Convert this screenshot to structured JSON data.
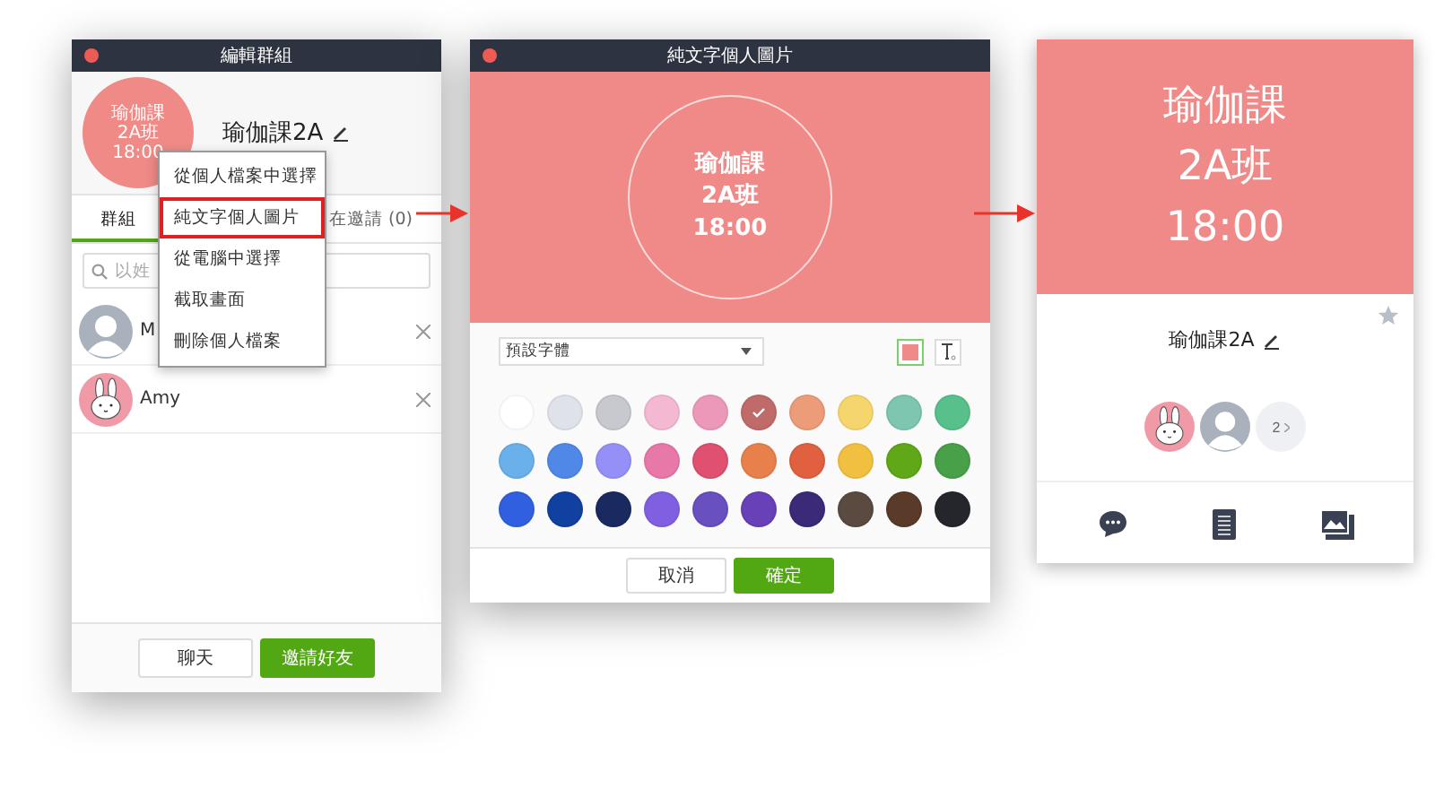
{
  "edit_group_window": {
    "title": "編輯群組",
    "avatar_lines": [
      "瑜伽課",
      "2A班",
      "18:00"
    ],
    "group_name": "瑜伽課2A",
    "tabs": [
      {
        "label": "群組",
        "selected": true
      },
      {
        "label": "在邀請 (0)",
        "selected": false
      }
    ],
    "search": {
      "placeholder": "以姓"
    },
    "members": [
      {
        "name": "M",
        "kind": "person"
      },
      {
        "name": "Amy",
        "kind": "bunny"
      }
    ],
    "buttons": [
      {
        "label": "聊天",
        "kind": "secondary"
      },
      {
        "label": "邀請好友",
        "kind": "primary"
      }
    ],
    "menu": [
      {
        "label": "從個人檔案中選擇",
        "selected": false
      },
      {
        "label": "純文字個人圖片",
        "selected": true
      },
      {
        "label": "從電腦中選擇",
        "selected": false
      },
      {
        "label": "截取畫面",
        "selected": false
      },
      {
        "label": "刪除個人檔案",
        "selected": false
      }
    ]
  },
  "text_image_window": {
    "title": "純文字個人圖片",
    "preview_lines": [
      "瑜伽課",
      "2A班",
      "18:00"
    ],
    "font_select": {
      "value": "預設字體"
    },
    "tools": [
      {
        "kind": "background",
        "selected": true
      },
      {
        "kind": "text",
        "selected": false
      }
    ],
    "palette": [
      {
        "color": "#ffffff",
        "selected": false
      },
      {
        "color": "#dfe2e9",
        "selected": false
      },
      {
        "color": "#c8c9ce",
        "selected": false
      },
      {
        "color": "#f4b8d2",
        "selected": false
      },
      {
        "color": "#ec98b8",
        "selected": false
      },
      {
        "color": "#c06a6a",
        "selected": true
      },
      {
        "color": "#ec9c78",
        "selected": false
      },
      {
        "color": "#f5d66e",
        "selected": false
      },
      {
        "color": "#7ec6b0",
        "selected": false
      },
      {
        "color": "#58c08a",
        "selected": false
      },
      {
        "color": "#6ab0ea",
        "selected": false
      },
      {
        "color": "#5088e8",
        "selected": false
      },
      {
        "color": "#9590f8",
        "selected": false
      },
      {
        "color": "#e878a8",
        "selected": false
      },
      {
        "color": "#e05070",
        "selected": false
      },
      {
        "color": "#e8804c",
        "selected": false
      },
      {
        "color": "#e06040",
        "selected": false
      },
      {
        "color": "#f2c040",
        "selected": false
      },
      {
        "color": "#60a818",
        "selected": false
      },
      {
        "color": "#48a048",
        "selected": false
      },
      {
        "color": "#3060e0",
        "selected": false
      },
      {
        "color": "#1040a0",
        "selected": false
      },
      {
        "color": "#1a2a60",
        "selected": false
      },
      {
        "color": "#8060e0",
        "selected": false
      },
      {
        "color": "#6850c0",
        "selected": false
      },
      {
        "color": "#6840b8",
        "selected": false
      },
      {
        "color": "#3a2a78",
        "selected": false
      },
      {
        "color": "#5a4a40",
        "selected": false
      },
      {
        "color": "#5a3a28",
        "selected": false
      },
      {
        "color": "#24262c",
        "selected": false
      }
    ],
    "buttons": [
      {
        "label": "取消",
        "kind": "secondary"
      },
      {
        "label": "確定",
        "kind": "primary"
      }
    ]
  },
  "profile_card": {
    "cover_lines": [
      "瑜伽課",
      "2A班",
      "18:00"
    ],
    "name": "瑜伽課2A",
    "favorite": false,
    "member_avatars": [
      {
        "kind": "bunny"
      },
      {
        "kind": "person"
      }
    ],
    "member_count": "2",
    "actions": [
      {
        "kind": "chat"
      },
      {
        "kind": "notes"
      },
      {
        "kind": "album"
      }
    ]
  }
}
